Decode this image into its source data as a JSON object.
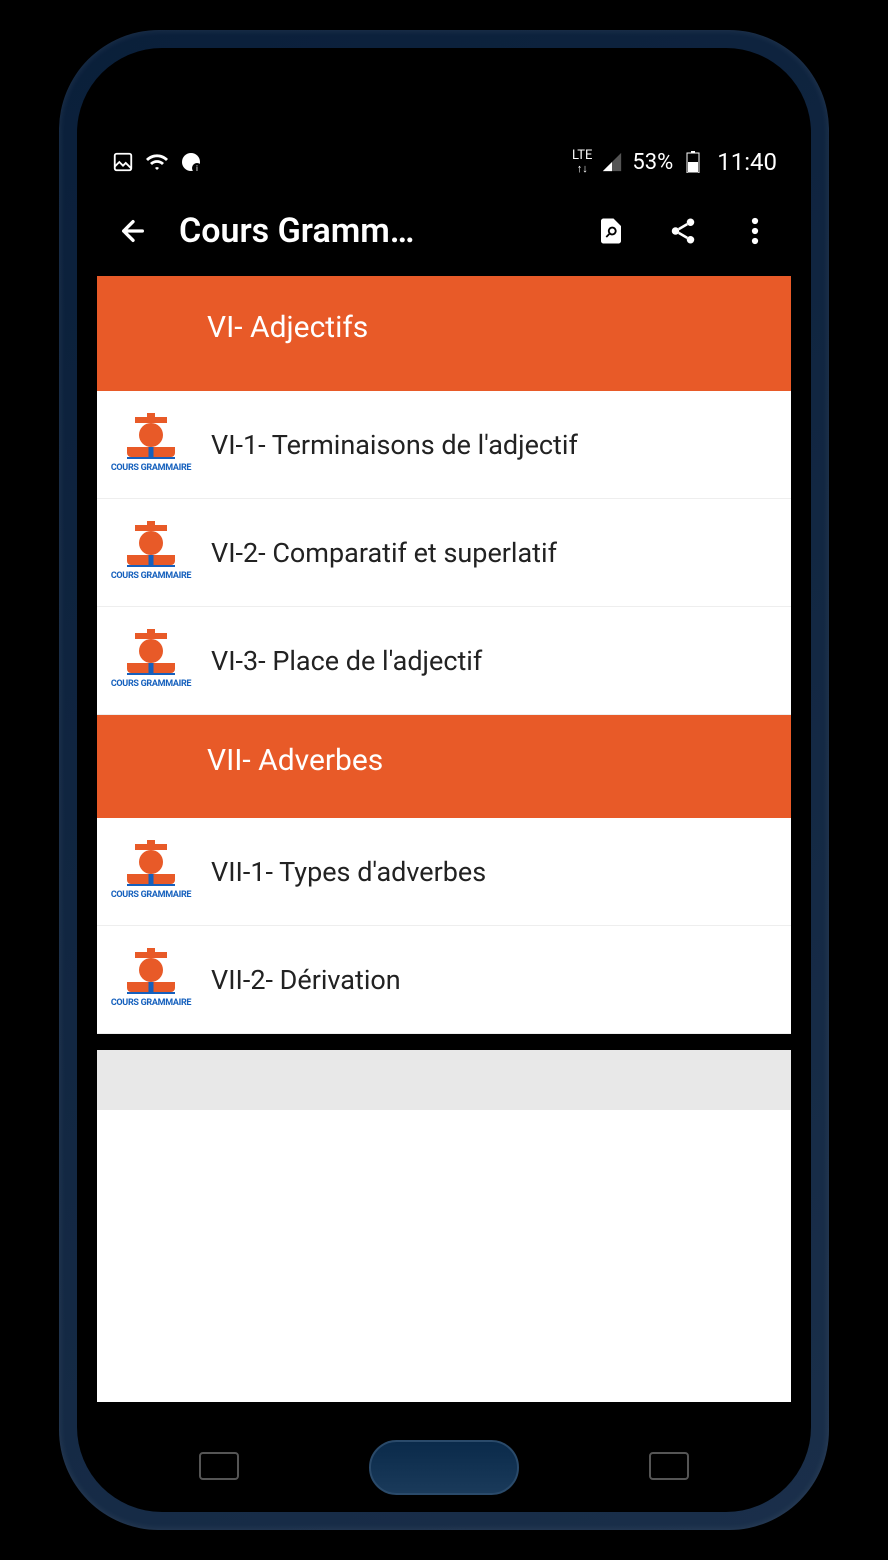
{
  "status": {
    "lte": "LTE",
    "battery_pct": "53%",
    "time": "11:40"
  },
  "appbar": {
    "title": "Cours Gramm…"
  },
  "thumb_label": "COURS GRAMMAIRE",
  "sections": [
    {
      "title": "VI- Adjectifs",
      "items": [
        {
          "label": "VI-1- Terminaisons de l'adjectif"
        },
        {
          "label": "VI-2- Comparatif et superlatif"
        },
        {
          "label": "VI-3- Place de l'adjectif"
        }
      ]
    },
    {
      "title": "VII- Adverbes",
      "items": [
        {
          "label": "VII-1- Types d'adverbes"
        },
        {
          "label": "VII-2- Dérivation"
        }
      ]
    }
  ]
}
